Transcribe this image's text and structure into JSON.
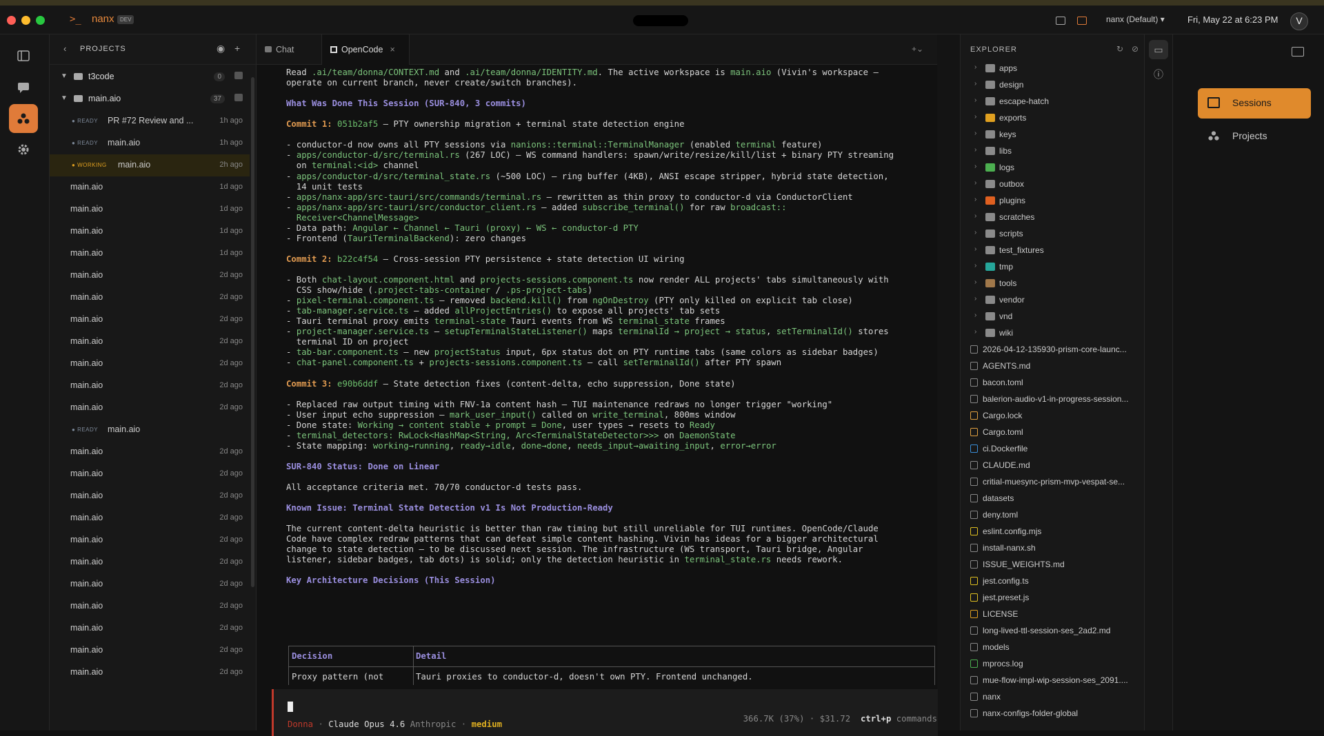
{
  "titlebar": {
    "app_name": "nanx",
    "badge": "DEV",
    "workspace_select": "nanx (Default) ▾",
    "datetime": "Fri, May 22 at 6:23 PM",
    "avatar": "V"
  },
  "projects": {
    "header": "PROJECTS",
    "rows": [
      {
        "kind": "group",
        "name": "t3code",
        "count": "0"
      },
      {
        "kind": "group",
        "name": "main.aio",
        "count": "37"
      },
      {
        "kind": "session",
        "status": "READY",
        "name": "PR #72 Review and ...",
        "time": "1h ago"
      },
      {
        "kind": "session",
        "status": "READY",
        "name": "main.aio",
        "time": "1h ago"
      },
      {
        "kind": "session",
        "status": "WORKING",
        "name": "main.aio",
        "time": "2h ago",
        "active": true
      },
      {
        "kind": "session",
        "name": "main.aio",
        "time": "1d ago"
      },
      {
        "kind": "session",
        "name": "main.aio",
        "time": "1d ago"
      },
      {
        "kind": "session",
        "name": "main.aio",
        "time": "1d ago"
      },
      {
        "kind": "session",
        "name": "main.aio",
        "time": "1d ago"
      },
      {
        "kind": "session",
        "name": "main.aio",
        "time": "2d ago"
      },
      {
        "kind": "session",
        "name": "main.aio",
        "time": "2d ago"
      },
      {
        "kind": "session",
        "name": "main.aio",
        "time": "2d ago"
      },
      {
        "kind": "session",
        "name": "main.aio",
        "time": "2d ago"
      },
      {
        "kind": "session",
        "name": "main.aio",
        "time": "2d ago"
      },
      {
        "kind": "session",
        "name": "main.aio",
        "time": "2d ago"
      },
      {
        "kind": "session",
        "name": "main.aio",
        "time": "2d ago"
      },
      {
        "kind": "session",
        "status": "READY",
        "name": "main.aio",
        "time": ""
      },
      {
        "kind": "session",
        "name": "main.aio",
        "time": "2d ago"
      },
      {
        "kind": "session",
        "name": "main.aio",
        "time": "2d ago"
      },
      {
        "kind": "session",
        "name": "main.aio",
        "time": "2d ago"
      },
      {
        "kind": "session",
        "name": "main.aio",
        "time": "2d ago"
      },
      {
        "kind": "session",
        "name": "main.aio",
        "time": "2d ago"
      },
      {
        "kind": "session",
        "name": "main.aio",
        "time": "2d ago"
      },
      {
        "kind": "session",
        "name": "main.aio",
        "time": "2d ago"
      },
      {
        "kind": "session",
        "name": "main.aio",
        "time": "2d ago"
      },
      {
        "kind": "session",
        "name": "main.aio",
        "time": "2d ago"
      },
      {
        "kind": "session",
        "name": "main.aio",
        "time": "2d ago"
      },
      {
        "kind": "session",
        "name": "main.aio",
        "time": "2d ago"
      }
    ]
  },
  "tabs": [
    {
      "label": "Chat",
      "active": false
    },
    {
      "label": "OpenCode",
      "active": true,
      "close": "×"
    }
  ],
  "terminal": {
    "lines": [
      [
        [
          "Read "
        ],
        [
          ".ai/team/donna/CONTEXT.md",
          "g"
        ],
        [
          " and "
        ],
        [
          ".ai/team/donna/IDENTITY.md",
          "g"
        ],
        [
          ". The active workspace is "
        ],
        [
          "main.aio",
          "g"
        ],
        [
          " (Vivin's workspace —"
        ]
      ],
      [
        [
          "operate on current branch, never create/switch branches)."
        ]
      ],
      [],
      [
        [
          "What Was Done This Session (SUR-840, 3 commits)",
          "h"
        ]
      ],
      [],
      [
        [
          "Commit 1: ",
          "o"
        ],
        [
          "051b2af5",
          "c"
        ],
        [
          " — PTY ownership migration + terminal state detection engine"
        ]
      ],
      [],
      [
        [
          "- conductor-d now owns all PTY sessions via "
        ],
        [
          "nanions::terminal::TerminalManager",
          "g"
        ],
        [
          " (enabled "
        ],
        [
          "terminal",
          "g"
        ],
        [
          " feature)"
        ]
      ],
      [
        [
          "- "
        ],
        [
          "apps/conductor-d/src/terminal.rs",
          "g"
        ],
        [
          " (267 LOC) — WS command handlers: spawn/write/resize/kill/list + binary PTY streaming"
        ]
      ],
      [
        [
          "  on "
        ],
        [
          "terminal:<id>",
          "g"
        ],
        [
          " channel"
        ]
      ],
      [
        [
          "- "
        ],
        [
          "apps/conductor-d/src/terminal_state.rs",
          "g"
        ],
        [
          " (~500 LOC) — ring buffer (4KB), ANSI escape stripper, hybrid state detection,"
        ]
      ],
      [
        [
          "  14 unit tests"
        ]
      ],
      [
        [
          "- "
        ],
        [
          "apps/nanx-app/src-tauri/src/commands/terminal.rs",
          "g"
        ],
        [
          " — rewritten as thin proxy to conductor-d via ConductorClient"
        ]
      ],
      [
        [
          "- "
        ],
        [
          "apps/nanx-app/src-tauri/src/conductor_client.rs",
          "g"
        ],
        [
          " — added "
        ],
        [
          "subscribe_terminal()",
          "g"
        ],
        [
          " for raw "
        ],
        [
          "broadcast::",
          "g"
        ]
      ],
      [
        [
          "  "
        ],
        [
          "Receiver<ChannelMessage>",
          "g"
        ]
      ],
      [
        [
          "- Data path: "
        ],
        [
          "Angular ← Channel ← Tauri (proxy) ← WS ← conductor-d PTY",
          "g"
        ]
      ],
      [
        [
          "- Frontend ("
        ],
        [
          "TauriTerminalBackend",
          "g"
        ],
        [
          "): zero changes"
        ]
      ],
      [],
      [
        [
          "Commit 2: ",
          "o"
        ],
        [
          "b22c4f54",
          "c"
        ],
        [
          " — Cross-session PTY persistence + state detection UI wiring"
        ]
      ],
      [],
      [
        [
          "- Both "
        ],
        [
          "chat-layout.component.html",
          "g"
        ],
        [
          " and "
        ],
        [
          "projects-sessions.component.ts",
          "g"
        ],
        [
          " now render ALL projects' tabs simultaneously with"
        ]
      ],
      [
        [
          "  CSS show/hide ("
        ],
        [
          ".project-tabs-container",
          "g"
        ],
        [
          " / "
        ],
        [
          ".ps-project-tabs",
          "g"
        ],
        [
          ")"
        ]
      ],
      [
        [
          "- "
        ],
        [
          "pixel-terminal.component.ts",
          "g"
        ],
        [
          " — removed "
        ],
        [
          "backend.kill()",
          "g"
        ],
        [
          " from "
        ],
        [
          "ngOnDestroy",
          "g"
        ],
        [
          " (PTY only killed on explicit tab close)"
        ]
      ],
      [
        [
          "- "
        ],
        [
          "tab-manager.service.ts",
          "g"
        ],
        [
          " — added "
        ],
        [
          "allProjectEntries()",
          "g"
        ],
        [
          " to expose all projects' tab sets"
        ]
      ],
      [
        [
          "- Tauri terminal proxy emits "
        ],
        [
          "terminal-state",
          "g"
        ],
        [
          " Tauri events from WS "
        ],
        [
          "terminal_state",
          "g"
        ],
        [
          " frames"
        ]
      ],
      [
        [
          "- "
        ],
        [
          "project-manager.service.ts",
          "g"
        ],
        [
          " — "
        ],
        [
          "setupTerminalStateListener()",
          "g"
        ],
        [
          " maps "
        ],
        [
          "terminalId → project → status",
          "g"
        ],
        [
          ", "
        ],
        [
          "setTerminalId()",
          "g"
        ],
        [
          " stores"
        ]
      ],
      [
        [
          "  terminal ID on project"
        ]
      ],
      [
        [
          "- "
        ],
        [
          "tab-bar.component.ts",
          "g"
        ],
        [
          " — new "
        ],
        [
          "projectStatus",
          "g"
        ],
        [
          " input, 6px status dot on PTY runtime tabs (same colors as sidebar badges)"
        ]
      ],
      [
        [
          "- "
        ],
        [
          "chat-panel.component.ts",
          "g"
        ],
        [
          " + "
        ],
        [
          "projects-sessions.component.ts",
          "g"
        ],
        [
          " — call "
        ],
        [
          "setTerminalId()",
          "g"
        ],
        [
          " after PTY spawn"
        ]
      ],
      [],
      [
        [
          "Commit 3: ",
          "o"
        ],
        [
          "e90b6ddf",
          "c"
        ],
        [
          " — State detection fixes (content-delta, echo suppression, Done state)"
        ]
      ],
      [],
      [
        [
          "- Replaced raw output timing with FNV-1a content hash — TUI maintenance redraws no longer trigger \"working\""
        ]
      ],
      [
        [
          "- User input echo suppression — "
        ],
        [
          "mark_user_input()",
          "g"
        ],
        [
          " called on "
        ],
        [
          "write_terminal",
          "g"
        ],
        [
          ", 800ms window"
        ]
      ],
      [
        [
          "- Done state: "
        ],
        [
          "Working → content stable + prompt = Done",
          "g"
        ],
        [
          ", user types → resets to "
        ],
        [
          "Ready",
          "g"
        ]
      ],
      [
        [
          "- "
        ],
        [
          "terminal_detectors: RwLock<HashMap<String, Arc<TerminalStateDetector>>>",
          "g"
        ],
        [
          " on "
        ],
        [
          "DaemonState",
          "g"
        ]
      ],
      [
        [
          "- State mapping: "
        ],
        [
          "working→running",
          "g"
        ],
        [
          ", "
        ],
        [
          "ready→idle",
          "g"
        ],
        [
          ", "
        ],
        [
          "done→done",
          "g"
        ],
        [
          ", "
        ],
        [
          "needs_input→awaiting_input",
          "g"
        ],
        [
          ", "
        ],
        [
          "error→error",
          "g"
        ]
      ],
      [],
      [
        [
          "SUR-840 Status: Done on Linear",
          "h"
        ]
      ],
      [],
      [
        [
          "All acceptance criteria met. 70/70 conductor-d tests pass."
        ]
      ],
      [],
      [
        [
          "Known Issue: Terminal State Detection v1 Is Not Production-Ready",
          "h"
        ]
      ],
      [],
      [
        [
          "The current content-delta heuristic is better than raw timing but still unreliable for TUI runtimes. OpenCode/Claude"
        ]
      ],
      [
        [
          "Code have complex redraw patterns that can defeat simple content hashing. Vivin has ideas for a bigger architectural"
        ]
      ],
      [
        [
          "change to state detection — to be discussed next session. The infrastructure (WS transport, Tauri bridge, Angular"
        ]
      ],
      [
        [
          "listener, sidebar badges, tab dots) is solid; only the detection heuristic in "
        ],
        [
          "terminal_state.rs",
          "g"
        ],
        [
          " needs rework."
        ]
      ],
      [],
      [
        [
          "Key Architecture Decisions (This Session)",
          "h"
        ]
      ]
    ],
    "table": {
      "headers": [
        "Decision",
        "Detail"
      ],
      "row": [
        "Proxy pattern (not",
        "Tauri proxies to conductor-d, doesn't own PTY. Frontend unchanged."
      ]
    }
  },
  "input_bar": {
    "agent": "Donna",
    "sep": "·",
    "model": "Claude Opus 4.6",
    "provider": "Anthropic",
    "effort": "medium"
  },
  "status_line": {
    "usage": "366.7K (37%) · $31.72",
    "shortcut": "ctrl+p",
    "shortcut_label": "commands"
  },
  "explorer": {
    "header": "EXPLORER",
    "items": [
      {
        "name": "apps",
        "type": "folder",
        "color": "#8a8a8a"
      },
      {
        "name": "design",
        "type": "folder",
        "color": "#8a8a8a"
      },
      {
        "name": "escape-hatch",
        "type": "folder",
        "color": "#8a8a8a"
      },
      {
        "name": "exports",
        "type": "folder",
        "color": "#e0a020"
      },
      {
        "name": "keys",
        "type": "folder",
        "color": "#8a8a8a"
      },
      {
        "name": "libs",
        "type": "folder",
        "color": "#8a8a8a"
      },
      {
        "name": "logs",
        "type": "folder",
        "color": "#4caf50"
      },
      {
        "name": "outbox",
        "type": "folder",
        "color": "#8a8a8a"
      },
      {
        "name": "plugins",
        "type": "folder",
        "color": "#e06020"
      },
      {
        "name": "scratches",
        "type": "folder",
        "color": "#8a8a8a"
      },
      {
        "name": "scripts",
        "type": "folder",
        "color": "#8a8a8a"
      },
      {
        "name": "test_fixtures",
        "type": "folder",
        "color": "#8a8a8a"
      },
      {
        "name": "tmp",
        "type": "folder",
        "color": "#26a69a"
      },
      {
        "name": "tools",
        "type": "folder",
        "color": "#a0784a"
      },
      {
        "name": "vendor",
        "type": "folder",
        "color": "#8a8a8a"
      },
      {
        "name": "vnd",
        "type": "folder",
        "color": "#8a8a8a"
      },
      {
        "name": "wiki",
        "type": "folder",
        "color": "#8a8a8a"
      },
      {
        "name": "2026-04-12-135930-prism-core-launc...",
        "type": "file",
        "color": "#888"
      },
      {
        "name": "AGENTS.md",
        "type": "file",
        "color": "#888"
      },
      {
        "name": "bacon.toml",
        "type": "file",
        "color": "#888"
      },
      {
        "name": "balerion-audio-v1-in-progress-session...",
        "type": "file",
        "color": "#888"
      },
      {
        "name": "Cargo.lock",
        "type": "file",
        "color": "#e0a040"
      },
      {
        "name": "Cargo.toml",
        "type": "file",
        "color": "#e0a040"
      },
      {
        "name": "ci.Dockerfile",
        "type": "file",
        "color": "#3a8ed8"
      },
      {
        "name": "CLAUDE.md",
        "type": "file",
        "color": "#888"
      },
      {
        "name": "critial-muesync-prism-mvp-vespat-se...",
        "type": "file",
        "color": "#888"
      },
      {
        "name": "datasets",
        "type": "file",
        "color": "#888"
      },
      {
        "name": "deny.toml",
        "type": "file",
        "color": "#888"
      },
      {
        "name": "eslint.config.mjs",
        "type": "file",
        "color": "#e0c020"
      },
      {
        "name": "install-nanx.sh",
        "type": "file",
        "color": "#888"
      },
      {
        "name": "ISSUE_WEIGHTS.md",
        "type": "file",
        "color": "#888"
      },
      {
        "name": "jest.config.ts",
        "type": "file",
        "color": "#e0c020"
      },
      {
        "name": "jest.preset.js",
        "type": "file",
        "color": "#e0c020"
      },
      {
        "name": "LICENSE",
        "type": "file",
        "color": "#e0a020"
      },
      {
        "name": "long-lived-ttl-session-ses_2ad2.md",
        "type": "file",
        "color": "#888"
      },
      {
        "name": "models",
        "type": "file",
        "color": "#888"
      },
      {
        "name": "mprocs.log",
        "type": "file",
        "color": "#4caf50"
      },
      {
        "name": "mue-flow-impl-wip-session-ses_2091....",
        "type": "file",
        "color": "#888"
      },
      {
        "name": "nanx",
        "type": "file",
        "color": "#888"
      },
      {
        "name": "nanx-configs-folder-global",
        "type": "file",
        "color": "#888"
      }
    ]
  },
  "sidepanel": {
    "sessions": "Sessions",
    "projects": "Projects"
  },
  "colors": {
    "accent": "#e08a2c",
    "heading": "#9b8fe0",
    "code": "#7cc47c",
    "commit": "#e09a50"
  }
}
